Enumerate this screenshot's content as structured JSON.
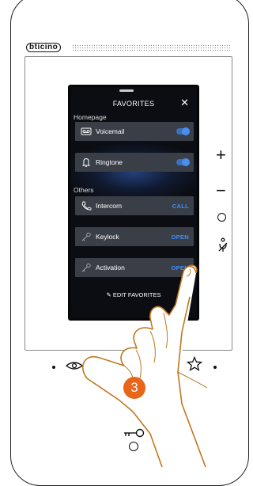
{
  "brand": {
    "name": "bticino"
  },
  "screen": {
    "title": "FAVORITES",
    "close_symbol": "✕",
    "sections": {
      "homepage": "Homepage",
      "others": "Others"
    },
    "rows": [
      {
        "label": "Voicemail",
        "control": "toggle",
        "on": true,
        "icon": "voicemail-icon"
      },
      {
        "label": "Ringtone",
        "control": "toggle",
        "on": true,
        "icon": "bell-icon"
      },
      {
        "label": "Intercom",
        "action": "CALL",
        "icon": "phone-icon"
      },
      {
        "label": "Keylock",
        "action": "OPEN",
        "icon": "key-icon"
      },
      {
        "label": "Activation",
        "action": "OPEN",
        "icon": "key-icon"
      }
    ],
    "edit_label": "EDIT FAVORITES"
  },
  "side_controls": {
    "plus": "+",
    "minus": "−"
  },
  "step_badge": "3",
  "colors": {
    "accent": "#3c8dff",
    "badge": "#e8651a",
    "row_bg": "#3a3f47"
  }
}
